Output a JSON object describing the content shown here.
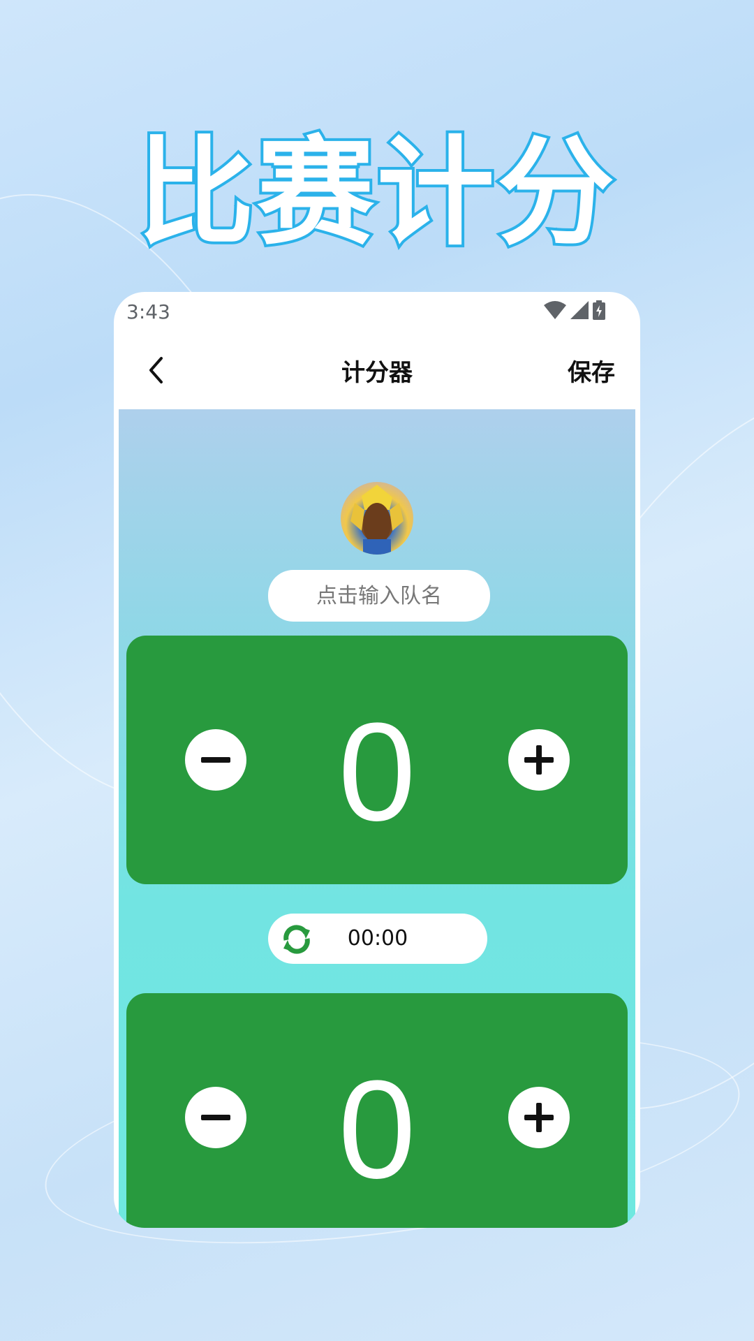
{
  "promo": {
    "title": "比赛计分"
  },
  "status_bar": {
    "time": "3:43",
    "icons": [
      "wifi-icon",
      "cellular-signal-icon",
      "battery-charging-icon"
    ]
  },
  "nav": {
    "back_icon": "chevron-left-icon",
    "title": "计分器",
    "save_label": "保存"
  },
  "team": {
    "avatar": "team-avatar",
    "name_value": "",
    "name_placeholder": "点击输入队名"
  },
  "scores": [
    {
      "value": "0",
      "minus_icon": "minus-icon",
      "plus_icon": "plus-icon"
    },
    {
      "value": "0",
      "minus_icon": "minus-icon",
      "plus_icon": "plus-icon"
    }
  ],
  "timer": {
    "reset_icon": "refresh-icon",
    "value": "00:00"
  },
  "colors": {
    "accent_green": "#289a3e",
    "title_stroke": "#2bb2ea",
    "background": "#c7e1f8"
  }
}
